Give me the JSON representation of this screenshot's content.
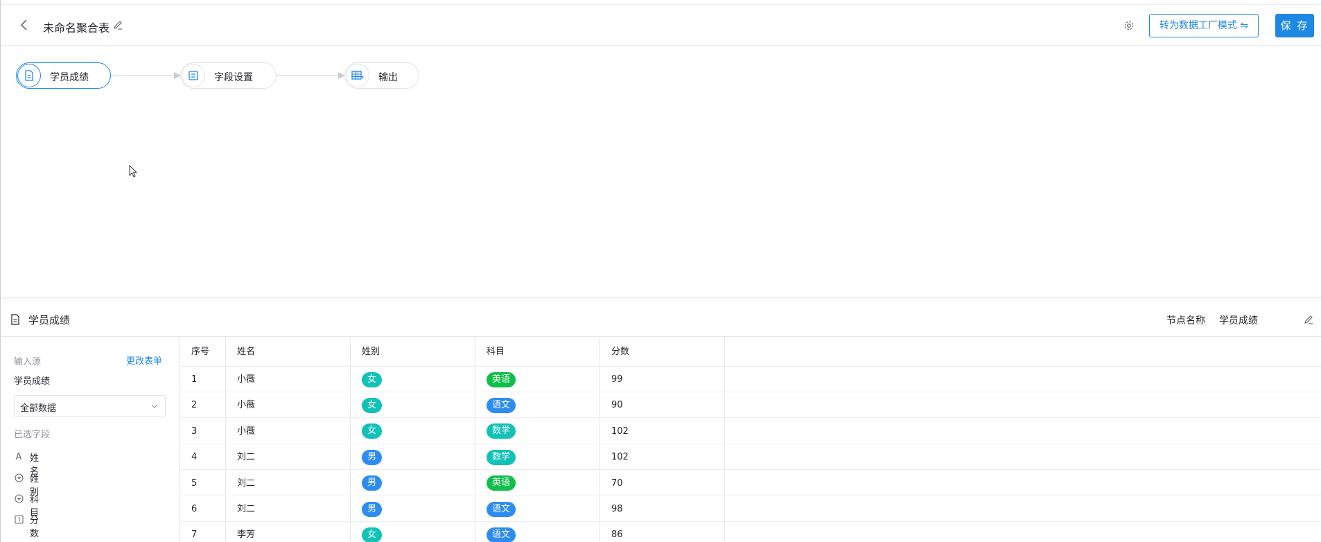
{
  "header": {
    "title": "未命名聚合表",
    "mode_button": "转为数据工厂模式 ⇋",
    "save_button": "保 存"
  },
  "flow": {
    "nodes": [
      {
        "label": "学员成绩",
        "icon": "form-icon",
        "active": true
      },
      {
        "label": "字段设置",
        "icon": "field-settings-icon",
        "active": false
      },
      {
        "label": "输出",
        "icon": "table-output-icon",
        "active": false
      }
    ]
  },
  "panel": {
    "title": "学员成绩",
    "node_name_label": "节点名称",
    "node_name_value": "学员成绩"
  },
  "sidebar": {
    "source_label": "输入源",
    "change_form": "更改表单",
    "source_value": "学员成绩",
    "filter_select": "全部数据",
    "fields_label": "已选字段",
    "fields": [
      {
        "label": "姓名",
        "icon": "text-field-icon"
      },
      {
        "label": "姓别",
        "icon": "dropdown-field-icon"
      },
      {
        "label": "科目",
        "icon": "dropdown-field-icon"
      },
      {
        "label": "分数",
        "icon": "number-field-icon"
      }
    ]
  },
  "table": {
    "columns": [
      "序号",
      "姓名",
      "姓别",
      "科目",
      "分数"
    ],
    "rows": [
      [
        "1",
        "小薇",
        "女",
        "英语",
        "99"
      ],
      [
        "2",
        "小薇",
        "女",
        "语文",
        "90"
      ],
      [
        "3",
        "小薇",
        "女",
        "数学",
        "102"
      ],
      [
        "4",
        "刘二",
        "男",
        "数学",
        "102"
      ],
      [
        "5",
        "刘二",
        "男",
        "英语",
        "70"
      ],
      [
        "6",
        "刘二",
        "男",
        "语文",
        "98"
      ],
      [
        "7",
        "李芳",
        "女",
        "语文",
        "86"
      ]
    ]
  },
  "colors": {
    "accent": "#1e88e5",
    "tag_female": "#12c2b8",
    "tag_male": "#2d8cf0",
    "tag_english": "#0fbf4a",
    "tag_chinese": "#2d8cf0",
    "tag_math": "#12c2b8"
  }
}
